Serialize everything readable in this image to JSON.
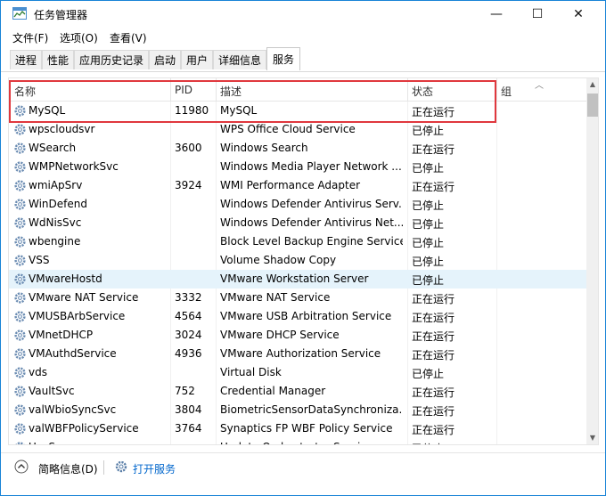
{
  "window": {
    "title": "任务管理器",
    "minimize": "—",
    "maximize": "☐",
    "close": "✕"
  },
  "menu": [
    "文件(F)",
    "选项(O)",
    "查看(V)"
  ],
  "tabs": [
    "进程",
    "性能",
    "应用历史记录",
    "启动",
    "用户",
    "详细信息",
    "服务"
  ],
  "active_tab": "服务",
  "columns": {
    "name": "名称",
    "pid": "PID",
    "desc": "描述",
    "status": "状态",
    "group": "组"
  },
  "services": [
    {
      "name": "MySQL",
      "pid": "11980",
      "desc": "MySQL",
      "status": "正在运行"
    },
    {
      "name": "wpscloudsvr",
      "pid": "",
      "desc": "WPS Office Cloud Service",
      "status": "已停止"
    },
    {
      "name": "WSearch",
      "pid": "3600",
      "desc": "Windows Search",
      "status": "正在运行"
    },
    {
      "name": "WMPNetworkSvc",
      "pid": "",
      "desc": "Windows Media Player Network ...",
      "status": "已停止"
    },
    {
      "name": "wmiApSrv",
      "pid": "3924",
      "desc": "WMI Performance Adapter",
      "status": "正在运行"
    },
    {
      "name": "WinDefend",
      "pid": "",
      "desc": "Windows Defender Antivirus Serv...",
      "status": "已停止"
    },
    {
      "name": "WdNisSvc",
      "pid": "",
      "desc": "Windows Defender Antivirus Net...",
      "status": "已停止"
    },
    {
      "name": "wbengine",
      "pid": "",
      "desc": "Block Level Backup Engine Service",
      "status": "已停止"
    },
    {
      "name": "VSS",
      "pid": "",
      "desc": "Volume Shadow Copy",
      "status": "已停止"
    },
    {
      "name": "VMwareHostd",
      "pid": "",
      "desc": "VMware Workstation Server",
      "status": "已停止"
    },
    {
      "name": "VMware NAT Service",
      "pid": "3332",
      "desc": "VMware NAT Service",
      "status": "正在运行"
    },
    {
      "name": "VMUSBArbService",
      "pid": "4564",
      "desc": "VMware USB Arbitration Service",
      "status": "正在运行"
    },
    {
      "name": "VMnetDHCP",
      "pid": "3024",
      "desc": "VMware DHCP Service",
      "status": "正在运行"
    },
    {
      "name": "VMAuthdService",
      "pid": "4936",
      "desc": "VMware Authorization Service",
      "status": "正在运行"
    },
    {
      "name": "vds",
      "pid": "",
      "desc": "Virtual Disk",
      "status": "已停止"
    },
    {
      "name": "VaultSvc",
      "pid": "752",
      "desc": "Credential Manager",
      "status": "正在运行"
    },
    {
      "name": "valWbioSyncSvc",
      "pid": "3804",
      "desc": "BiometricSensorDataSynchroniza...",
      "status": "正在运行"
    },
    {
      "name": "valWBFPolicyService",
      "pid": "3764",
      "desc": "Synaptics FP WBF Policy Service",
      "status": "正在运行"
    },
    {
      "name": "UsoSvc",
      "pid": "",
      "desc": "Update Orchestrator Service",
      "status": "已停止"
    }
  ],
  "footer": {
    "fewer_details": "简略信息(D)",
    "open_services": "打开服务"
  },
  "colors": {
    "accent": "#1883d7",
    "highlight": "#e0383e",
    "link": "#0066cc",
    "selected_row": "#e5f3fb"
  },
  "icons": {
    "app": "task-manager-icon",
    "service": "gear-icon",
    "collapse": "chevron-up-icon",
    "services_link": "services-gear-icon"
  }
}
